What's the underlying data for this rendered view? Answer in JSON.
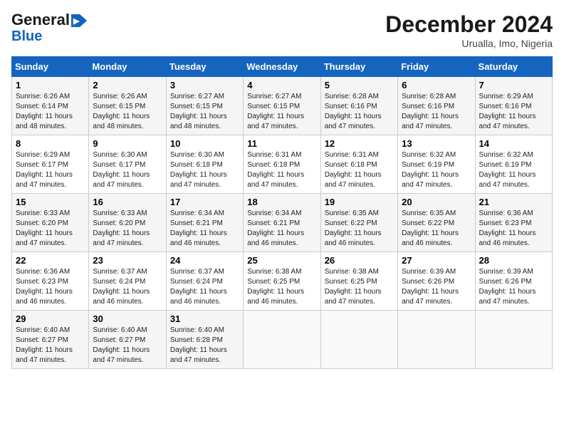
{
  "header": {
    "logo_line1": "General",
    "logo_line2": "Blue",
    "month_title": "December 2024",
    "location": "Urualla, Imo, Nigeria"
  },
  "days_of_week": [
    "Sunday",
    "Monday",
    "Tuesday",
    "Wednesday",
    "Thursday",
    "Friday",
    "Saturday"
  ],
  "weeks": [
    [
      {
        "day": "1",
        "sunrise": "6:26 AM",
        "sunset": "6:14 PM",
        "daylight": "11 hours and 48 minutes."
      },
      {
        "day": "2",
        "sunrise": "6:26 AM",
        "sunset": "6:15 PM",
        "daylight": "11 hours and 48 minutes."
      },
      {
        "day": "3",
        "sunrise": "6:27 AM",
        "sunset": "6:15 PM",
        "daylight": "11 hours and 48 minutes."
      },
      {
        "day": "4",
        "sunrise": "6:27 AM",
        "sunset": "6:15 PM",
        "daylight": "11 hours and 47 minutes."
      },
      {
        "day": "5",
        "sunrise": "6:28 AM",
        "sunset": "6:16 PM",
        "daylight": "11 hours and 47 minutes."
      },
      {
        "day": "6",
        "sunrise": "6:28 AM",
        "sunset": "6:16 PM",
        "daylight": "11 hours and 47 minutes."
      },
      {
        "day": "7",
        "sunrise": "6:29 AM",
        "sunset": "6:16 PM",
        "daylight": "11 hours and 47 minutes."
      }
    ],
    [
      {
        "day": "8",
        "sunrise": "6:29 AM",
        "sunset": "6:17 PM",
        "daylight": "11 hours and 47 minutes."
      },
      {
        "day": "9",
        "sunrise": "6:30 AM",
        "sunset": "6:17 PM",
        "daylight": "11 hours and 47 minutes."
      },
      {
        "day": "10",
        "sunrise": "6:30 AM",
        "sunset": "6:18 PM",
        "daylight": "11 hours and 47 minutes."
      },
      {
        "day": "11",
        "sunrise": "6:31 AM",
        "sunset": "6:18 PM",
        "daylight": "11 hours and 47 minutes."
      },
      {
        "day": "12",
        "sunrise": "6:31 AM",
        "sunset": "6:18 PM",
        "daylight": "11 hours and 47 minutes."
      },
      {
        "day": "13",
        "sunrise": "6:32 AM",
        "sunset": "6:19 PM",
        "daylight": "11 hours and 47 minutes."
      },
      {
        "day": "14",
        "sunrise": "6:32 AM",
        "sunset": "6:19 PM",
        "daylight": "11 hours and 47 minutes."
      }
    ],
    [
      {
        "day": "15",
        "sunrise": "6:33 AM",
        "sunset": "6:20 PM",
        "daylight": "11 hours and 47 minutes."
      },
      {
        "day": "16",
        "sunrise": "6:33 AM",
        "sunset": "6:20 PM",
        "daylight": "11 hours and 47 minutes."
      },
      {
        "day": "17",
        "sunrise": "6:34 AM",
        "sunset": "6:21 PM",
        "daylight": "11 hours and 46 minutes."
      },
      {
        "day": "18",
        "sunrise": "6:34 AM",
        "sunset": "6:21 PM",
        "daylight": "11 hours and 46 minutes."
      },
      {
        "day": "19",
        "sunrise": "6:35 AM",
        "sunset": "6:22 PM",
        "daylight": "11 hours and 46 minutes."
      },
      {
        "day": "20",
        "sunrise": "6:35 AM",
        "sunset": "6:22 PM",
        "daylight": "11 hours and 46 minutes."
      },
      {
        "day": "21",
        "sunrise": "6:36 AM",
        "sunset": "6:23 PM",
        "daylight": "11 hours and 46 minutes."
      }
    ],
    [
      {
        "day": "22",
        "sunrise": "6:36 AM",
        "sunset": "6:23 PM",
        "daylight": "11 hours and 46 minutes."
      },
      {
        "day": "23",
        "sunrise": "6:37 AM",
        "sunset": "6:24 PM",
        "daylight": "11 hours and 46 minutes."
      },
      {
        "day": "24",
        "sunrise": "6:37 AM",
        "sunset": "6:24 PM",
        "daylight": "11 hours and 46 minutes."
      },
      {
        "day": "25",
        "sunrise": "6:38 AM",
        "sunset": "6:25 PM",
        "daylight": "11 hours and 46 minutes."
      },
      {
        "day": "26",
        "sunrise": "6:38 AM",
        "sunset": "6:25 PM",
        "daylight": "11 hours and 47 minutes."
      },
      {
        "day": "27",
        "sunrise": "6:39 AM",
        "sunset": "6:26 PM",
        "daylight": "11 hours and 47 minutes."
      },
      {
        "day": "28",
        "sunrise": "6:39 AM",
        "sunset": "6:26 PM",
        "daylight": "11 hours and 47 minutes."
      }
    ],
    [
      {
        "day": "29",
        "sunrise": "6:40 AM",
        "sunset": "6:27 PM",
        "daylight": "11 hours and 47 minutes."
      },
      {
        "day": "30",
        "sunrise": "6:40 AM",
        "sunset": "6:27 PM",
        "daylight": "11 hours and 47 minutes."
      },
      {
        "day": "31",
        "sunrise": "6:40 AM",
        "sunset": "6:28 PM",
        "daylight": "11 hours and 47 minutes."
      },
      null,
      null,
      null,
      null
    ]
  ]
}
